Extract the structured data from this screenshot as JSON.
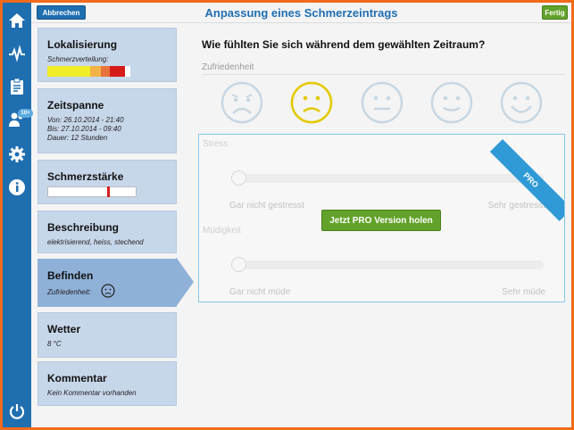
{
  "header": {
    "title": "Anpassung eines Schmerzeintrags",
    "cancel_label": "Abbrechen",
    "done_label": "Fertig"
  },
  "rail": {
    "icons": [
      "home-icon",
      "pulse-icon",
      "clipboard-icon",
      "users-icon",
      "gear-icon",
      "info-icon",
      "power-icon"
    ],
    "badge": "10+"
  },
  "cards": {
    "localization": {
      "title": "Lokalisierung",
      "sub": "Schmerzverteilung:"
    },
    "timespan": {
      "title": "Zeitspanne",
      "from": "Von: 26.10.2014 - 21:40",
      "to": "Bis: 27.10.2014 - 09:40",
      "duration": "Dauer: 12 Stunden"
    },
    "intensity": {
      "title": "Schmerzstärke",
      "level": 0.68
    },
    "description": {
      "title": "Beschreibung",
      "text": "elektrisierend, heiss, stechend"
    },
    "wellbeing": {
      "title": "Befinden",
      "text": "Zufriedenheit:"
    },
    "weather": {
      "title": "Wetter",
      "text": "8 °C"
    },
    "comment": {
      "title": "Kommentar",
      "text": "Kein Kommentar vorhanden"
    }
  },
  "main": {
    "question": "Wie fühlten Sie sich während dem gewählten Zeitraum?",
    "satisfaction_label": "Zufriedenheit",
    "faces": [
      "very-sad-face-icon",
      "sad-face-icon",
      "neutral-face-icon",
      "slight-smile-face-icon",
      "happy-face-icon"
    ],
    "selected_face": 1,
    "stress": {
      "label": "Stress",
      "min": "Gar nicht gestresst",
      "max": "Sehr gestresst"
    },
    "fatigue": {
      "label": "Müdigkeit",
      "min": "Gar nicht müde",
      "max": "Sehr müde"
    },
    "pro_ribbon": "PRO",
    "pro_button": "Jetzt PRO Version holen"
  },
  "colors": {
    "accent": "#1f6eb0",
    "green": "#62a22a",
    "frame": "#f26a1b",
    "selected_face": "#e3c900"
  }
}
